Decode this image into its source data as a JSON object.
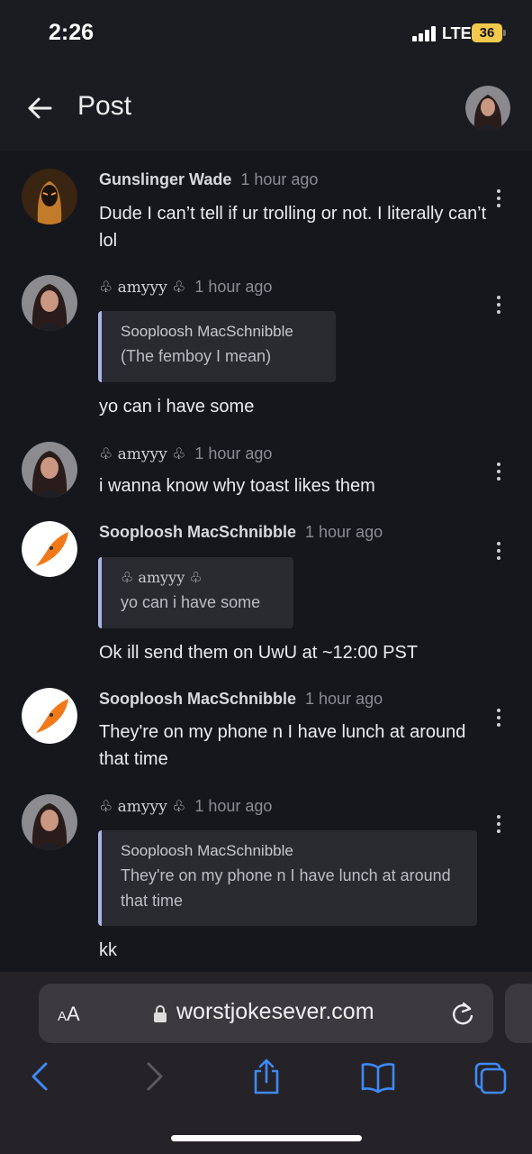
{
  "status_bar": {
    "time": "2:26",
    "network": "LTE",
    "battery": "36"
  },
  "header": {
    "title": "Post"
  },
  "comments": [
    {
      "author": "Gunslinger Wade",
      "time": "1 hour ago",
      "text": "Dude I can’t tell if ur trolling or not. I literally can’t lol"
    },
    {
      "author": "♧ amyyy ♧",
      "time": "1 hour ago",
      "quote": {
        "author": "Sooploosh MacSchnibble",
        "text": "(The femboy I mean)"
      },
      "text": "yo can i have some"
    },
    {
      "author": "♧ amyyy ♧",
      "time": "1 hour ago",
      "text": "i wanna know why toast likes them"
    },
    {
      "author": "Sooploosh MacSchnibble",
      "time": "1 hour ago",
      "quote": {
        "author": "♧ amyyy ♧",
        "text": "yo can i have some"
      },
      "text": "Ok ill send them on UwU at ~12:00 PST"
    },
    {
      "author": "Sooploosh MacSchnibble",
      "time": "1 hour ago",
      "text": "They're on my phone n I have lunch at around that time"
    },
    {
      "author": "♧ amyyy ♧",
      "time": "1 hour ago",
      "quote": {
        "author": "Sooploosh MacSchnibble",
        "text": "They're on my phone n I have lunch at around that time"
      },
      "text": "kk"
    }
  ],
  "browser": {
    "text_size_small": "A",
    "text_size_large": "A",
    "url": "worstjokesever.com"
  },
  "icons": {
    "back": "arrow-left-icon",
    "more": "kebab-menu-icon",
    "lock": "lock-icon",
    "reload": "reload-icon",
    "nav_back": "chevron-left-icon",
    "nav_forward": "chevron-right-icon",
    "share": "share-icon",
    "bookmarks": "book-icon",
    "tabs": "tabs-icon"
  },
  "colors": {
    "background": "#16171c",
    "quote_bar": "#a9b6e6",
    "accent_blue": "#3d8af7"
  }
}
